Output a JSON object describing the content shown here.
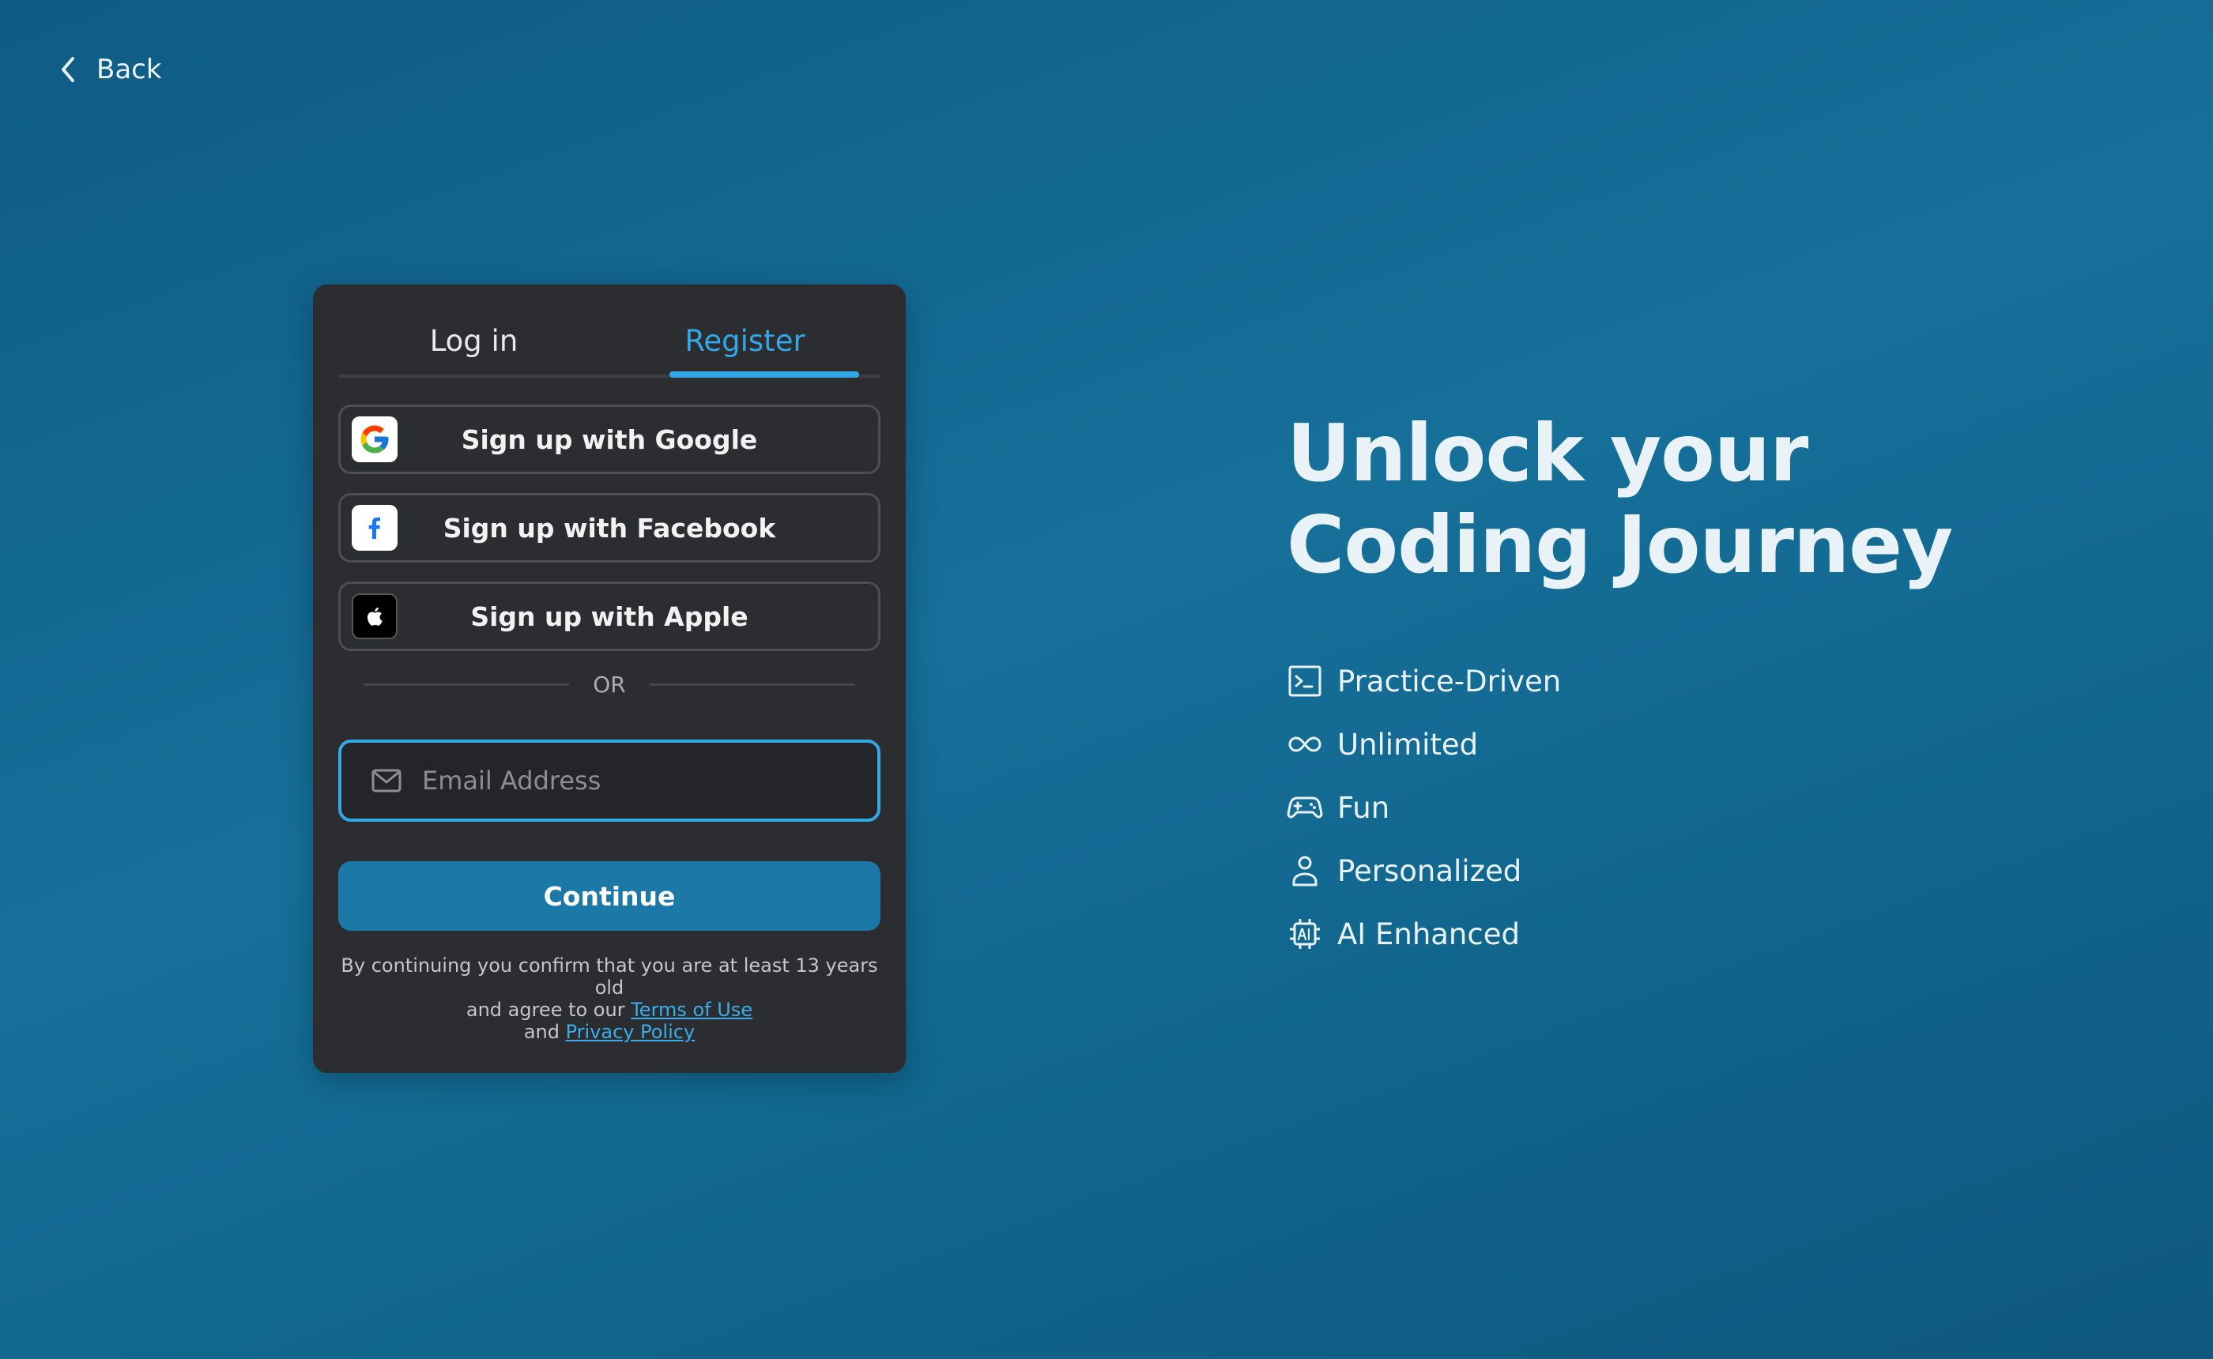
{
  "back": {
    "label": "Back",
    "icon": "chevron-left-icon"
  },
  "tabs": [
    {
      "label": "Log in",
      "active": false
    },
    {
      "label": "Register",
      "active": true
    }
  ],
  "social": {
    "google": {
      "label": "Sign up with Google",
      "icon": "google-icon"
    },
    "facebook": {
      "label": "Sign up with Facebook",
      "icon": "facebook-icon"
    },
    "apple": {
      "label": "Sign up with Apple",
      "icon": "apple-icon"
    }
  },
  "divider": {
    "label": "OR"
  },
  "email": {
    "placeholder": "Email Address",
    "value": "",
    "icon": "mail-icon"
  },
  "continue": {
    "label": "Continue"
  },
  "legal": {
    "line1": "By continuing you confirm that you are at least 13 years old",
    "line2": "and agree to our",
    "terms": "Terms of Use",
    "and": "and",
    "privacy": "Privacy Policy"
  },
  "headline": {
    "line1": "Unlock your",
    "line2": "Coding Journey"
  },
  "features": [
    {
      "label": "Practice-Driven",
      "icon": "terminal-icon"
    },
    {
      "label": "Unlimited",
      "icon": "infinity-icon"
    },
    {
      "label": "Fun",
      "icon": "gamepad-icon"
    },
    {
      "label": "Personalized",
      "icon": "user-icon"
    },
    {
      "label": "AI Enhanced",
      "icon": "ai-chip-icon"
    }
  ],
  "colors": {
    "accent": "#33a8e6",
    "card": "#2c2d30",
    "button": "#1c78a6",
    "background": "#16709a"
  }
}
